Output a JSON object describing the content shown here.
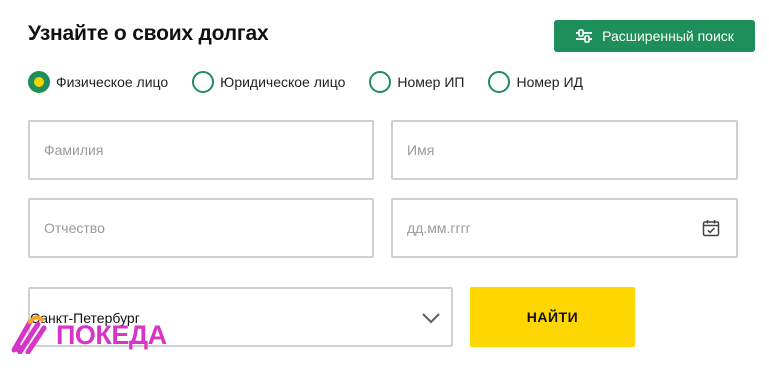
{
  "form": {
    "title": "Узнайте о своих долгах",
    "advanced_search_label": "Расширенный поиск",
    "radios": [
      {
        "label": "Физическое лицо",
        "checked": true
      },
      {
        "label": "Юридическое лицо",
        "checked": false
      },
      {
        "label": "Номер ИП",
        "checked": false
      },
      {
        "label": "Номер ИД",
        "checked": false
      }
    ],
    "fields": {
      "surname_placeholder": "Фамилия",
      "name_placeholder": "Имя",
      "patronymic_placeholder": "Отчество",
      "date_placeholder": "дд.мм.гггг"
    },
    "region_value": "Санкт-Петербург",
    "search_label": "НАЙТИ"
  },
  "watermark": {
    "text": "ПОКЕДА"
  },
  "colors": {
    "accent_green": "#1e8e5a",
    "accent_yellow": "#ffd700",
    "watermark": "#d636c8"
  },
  "icons": [
    "sliders-icon",
    "calendar-icon",
    "chevron-down-icon",
    "hand-logo-icon"
  ]
}
